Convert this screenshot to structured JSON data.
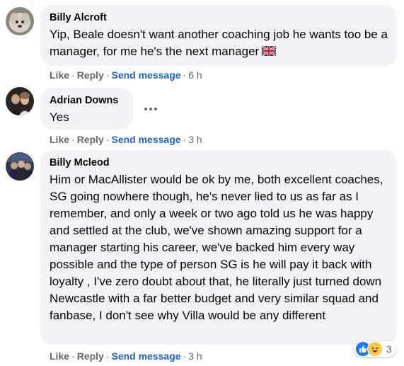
{
  "comments": [
    {
      "author": "Billy Alcroft",
      "text": "Yip, Beale doesn't want another coaching job he wants too be a manager, for me he's the next manager",
      "flag_icon": "uk-flag-icon",
      "actions": {
        "like": "Like",
        "reply": "Reply",
        "send": "Send message",
        "time": "6 h"
      }
    },
    {
      "author": "Adrian Downs",
      "text": "Yes",
      "more_icon": "more-options-icon",
      "actions": {
        "like": "Like",
        "reply": "Reply",
        "send": "Send message",
        "time": "3 h"
      }
    },
    {
      "author": "Billy Mcleod",
      "text": "Him or MacAllister would be ok by me, both excellent coaches, SG going nowhere though, he's never lied to us as far as I remember, and only a week or two ago told us he was happy and settled at the club, we've shown amazing support for a manager starting his career, we've backed him every way possible and the type of person SG is he will pay it back with loyalty , I've zero doubt about that, he literally just turned down Newcastle with a far better budget and very similar squad and fanbase, I don't see why Villa would be any different",
      "actions": {
        "like": "Like",
        "reply": "Reply",
        "send": "Send message",
        "time": "3 h"
      },
      "reactions": {
        "icons": [
          "like-icon",
          "haha-icon"
        ],
        "count": "3"
      }
    }
  ],
  "separator": "·",
  "colors": {
    "bubble": "#f0f2f5",
    "link": "#1b62d1",
    "muted": "#65676b",
    "like_blue": "#1877f2"
  }
}
